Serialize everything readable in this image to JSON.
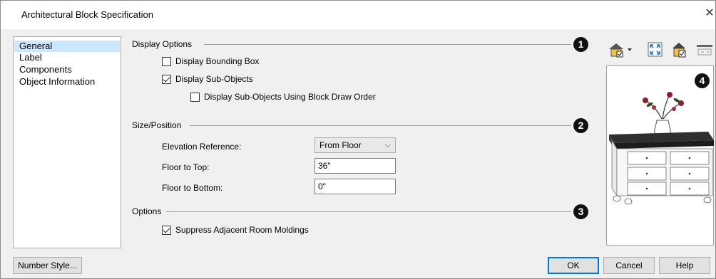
{
  "window": {
    "title": "Architectural Block Specification",
    "close_glyph": "✕"
  },
  "sidebar": {
    "items": [
      {
        "label": "General",
        "selected": true
      },
      {
        "label": "Label",
        "selected": false
      },
      {
        "label": "Components",
        "selected": false
      },
      {
        "label": "Object Information",
        "selected": false
      }
    ]
  },
  "display_options": {
    "heading": "Display Options",
    "badge": "1",
    "bounding_box": {
      "label": "Display Bounding Box",
      "checked": false
    },
    "sub_objects": {
      "label": "Display Sub-Objects",
      "checked": true
    },
    "block_draw_order": {
      "label": "Display Sub-Objects Using Block Draw Order",
      "checked": false
    }
  },
  "size_position": {
    "heading": "Size/Position",
    "badge": "2",
    "elevation_reference": {
      "label": "Elevation Reference:",
      "value": "From Floor"
    },
    "floor_to_top": {
      "label": "Floor to Top:",
      "value": "36\""
    },
    "floor_to_bottom": {
      "label": "Floor to Bottom:",
      "value": "0\""
    }
  },
  "options": {
    "heading": "Options",
    "badge": "3",
    "suppress_moldings": {
      "label": "Suppress Adjacent Room Moldings",
      "checked": true
    }
  },
  "preview": {
    "badge": "4"
  },
  "footer": {
    "number_style_label": "Number Style...",
    "ok_label": "OK",
    "cancel_label": "Cancel",
    "help_label": "Help"
  },
  "colors": {
    "selection": "#cce8ff",
    "badge": "#111111",
    "default_button_border": "#0078d7"
  }
}
